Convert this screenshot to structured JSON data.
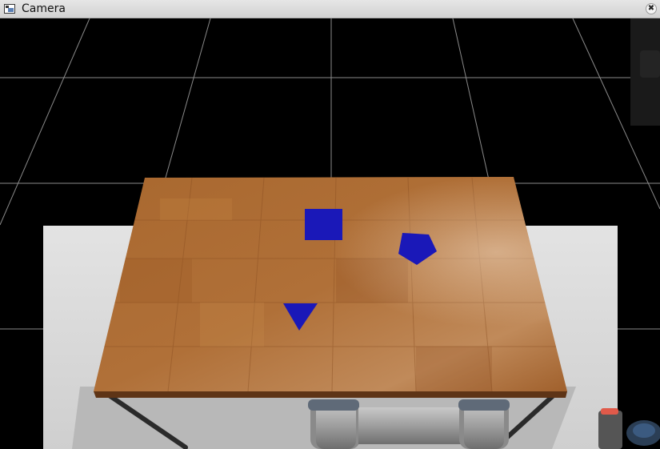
{
  "window": {
    "title": "Camera",
    "close_glyph": "✖",
    "icon": "window-icon"
  },
  "scene": {
    "background": "#000000",
    "grid_color": "#8a8a8a",
    "floor_color": "#d9d9d9",
    "table_color": "#a4622c",
    "shape_color": "#1a18b8",
    "objects": [
      {
        "name": "blue-square",
        "shape": "square"
      },
      {
        "name": "blue-pentagon",
        "shape": "pentagon"
      },
      {
        "name": "blue-triangle",
        "shape": "triangle"
      }
    ]
  }
}
